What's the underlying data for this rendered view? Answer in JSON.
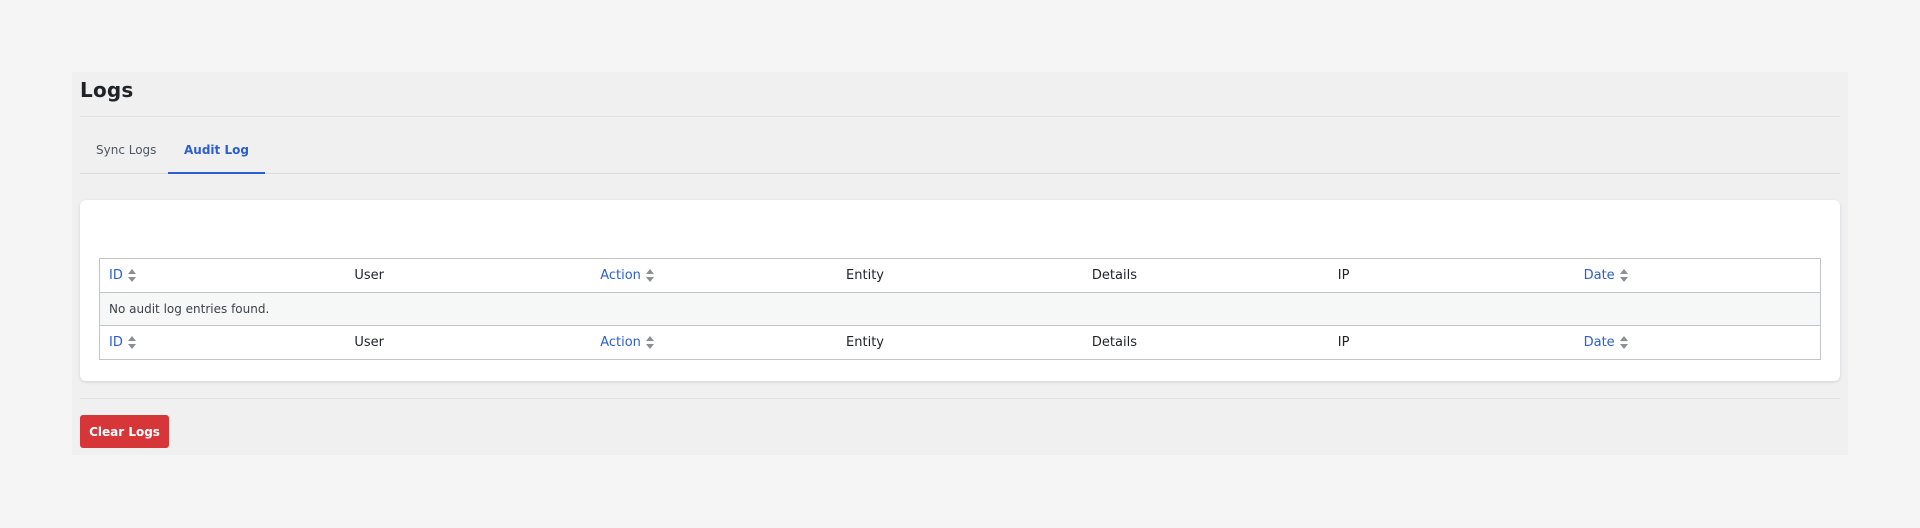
{
  "page": {
    "title": "Logs"
  },
  "tabs": [
    {
      "label": "Sync Logs",
      "active": false
    },
    {
      "label": "Audit Log",
      "active": true
    }
  ],
  "table": {
    "columns": [
      {
        "label": "ID",
        "sortable": true
      },
      {
        "label": "User",
        "sortable": false
      },
      {
        "label": "Action",
        "sortable": true
      },
      {
        "label": "Entity",
        "sortable": false
      },
      {
        "label": "Details",
        "sortable": false
      },
      {
        "label": "IP",
        "sortable": false
      },
      {
        "label": "Date",
        "sortable": true
      }
    ],
    "empty_message": "No audit log entries found."
  },
  "actions": {
    "clear_label": "Clear Logs"
  },
  "colors": {
    "accent": "#2c5ece",
    "danger": "#d63638",
    "background": "#f5f5f6"
  }
}
